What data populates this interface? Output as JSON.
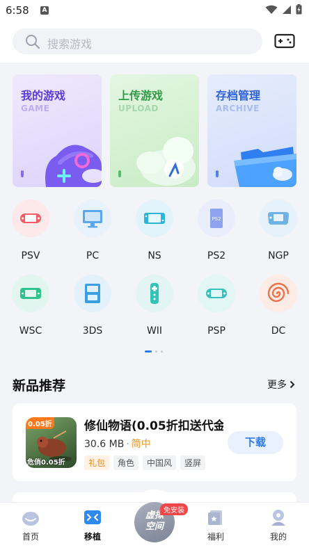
{
  "status": {
    "time": "6:58",
    "app_icon": "A"
  },
  "search": {
    "placeholder": "搜索游戏"
  },
  "feature_cards": [
    {
      "title": "我的游戏",
      "subtitle": "GAME"
    },
    {
      "title": "上传游戏",
      "subtitle": "UPLOAD"
    },
    {
      "title": "存档管理",
      "subtitle": "ARCHIVE"
    }
  ],
  "platforms": [
    {
      "label": "PSV",
      "icon": "psvita-icon"
    },
    {
      "label": "PC",
      "icon": "monitor-icon"
    },
    {
      "label": "NS",
      "icon": "switch-icon"
    },
    {
      "label": "PS2",
      "icon": "ps2-icon",
      "icon_text": "PS2"
    },
    {
      "label": "NGP",
      "icon": "ngp-icon"
    },
    {
      "label": "WSC",
      "icon": "wonderswan-icon"
    },
    {
      "label": "3DS",
      "icon": "3ds-icon"
    },
    {
      "label": "WII",
      "icon": "wii-remote-icon"
    },
    {
      "label": "PSP",
      "icon": "psp-icon"
    },
    {
      "label": "DC",
      "icon": "dreamcast-icon"
    }
  ],
  "section": {
    "title": "新品推荐",
    "more": "更多"
  },
  "game": {
    "name": "修仙物语(0.05折扣送代金",
    "size": "30.6 MB",
    "lang": "简中",
    "cover_tag": "0.05折",
    "cover_caption": "危俏0.05折",
    "tags": [
      "礼包",
      "角色",
      "中国风",
      "竖屏"
    ],
    "download": "下载"
  },
  "tabbar": {
    "home": "首页",
    "port": "移植",
    "center": "虚拟空间",
    "center_badge": "免安装",
    "welfare": "福利",
    "mine": "我的"
  },
  "colors": {
    "accent": "#2e7be8",
    "badge": "#f04848",
    "lang": "#f29418"
  }
}
